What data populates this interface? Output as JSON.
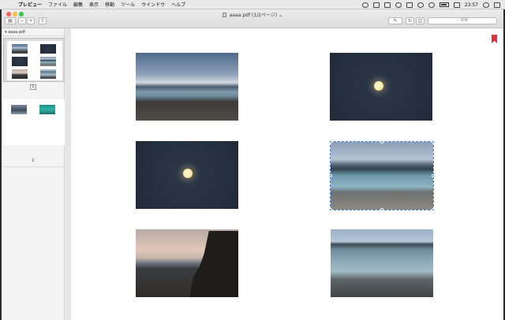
{
  "menubar": {
    "app_name": "プレビュー",
    "items": [
      "ファイル",
      "編集",
      "表示",
      "移動",
      "ツール",
      "ウインドウ",
      "ヘルプ"
    ],
    "clock": "23:57"
  },
  "window": {
    "title": "aaaa.pdf",
    "page_info": "(1/2ページ)",
    "search_placeholder": "検索"
  },
  "sidebar": {
    "header": "aaaa.pdf",
    "pages": [
      {
        "label": "1"
      },
      {
        "label": "2"
      }
    ]
  },
  "document": {
    "photos": [
      {
        "name": "beach-dusk-photo",
        "scene": "beach"
      },
      {
        "name": "moon-photo-1",
        "scene": "moon"
      },
      {
        "name": "moon-photo-2",
        "scene": "moon"
      },
      {
        "name": "lagoon-photo",
        "scene": "lagoon",
        "selected": true
      },
      {
        "name": "cliff-sunset-photo",
        "scene": "sunset"
      },
      {
        "name": "shoreline-photo",
        "scene": "shore"
      }
    ]
  },
  "colors": {
    "bookmark": "#e0323c",
    "selection": "#3b7bd8"
  }
}
